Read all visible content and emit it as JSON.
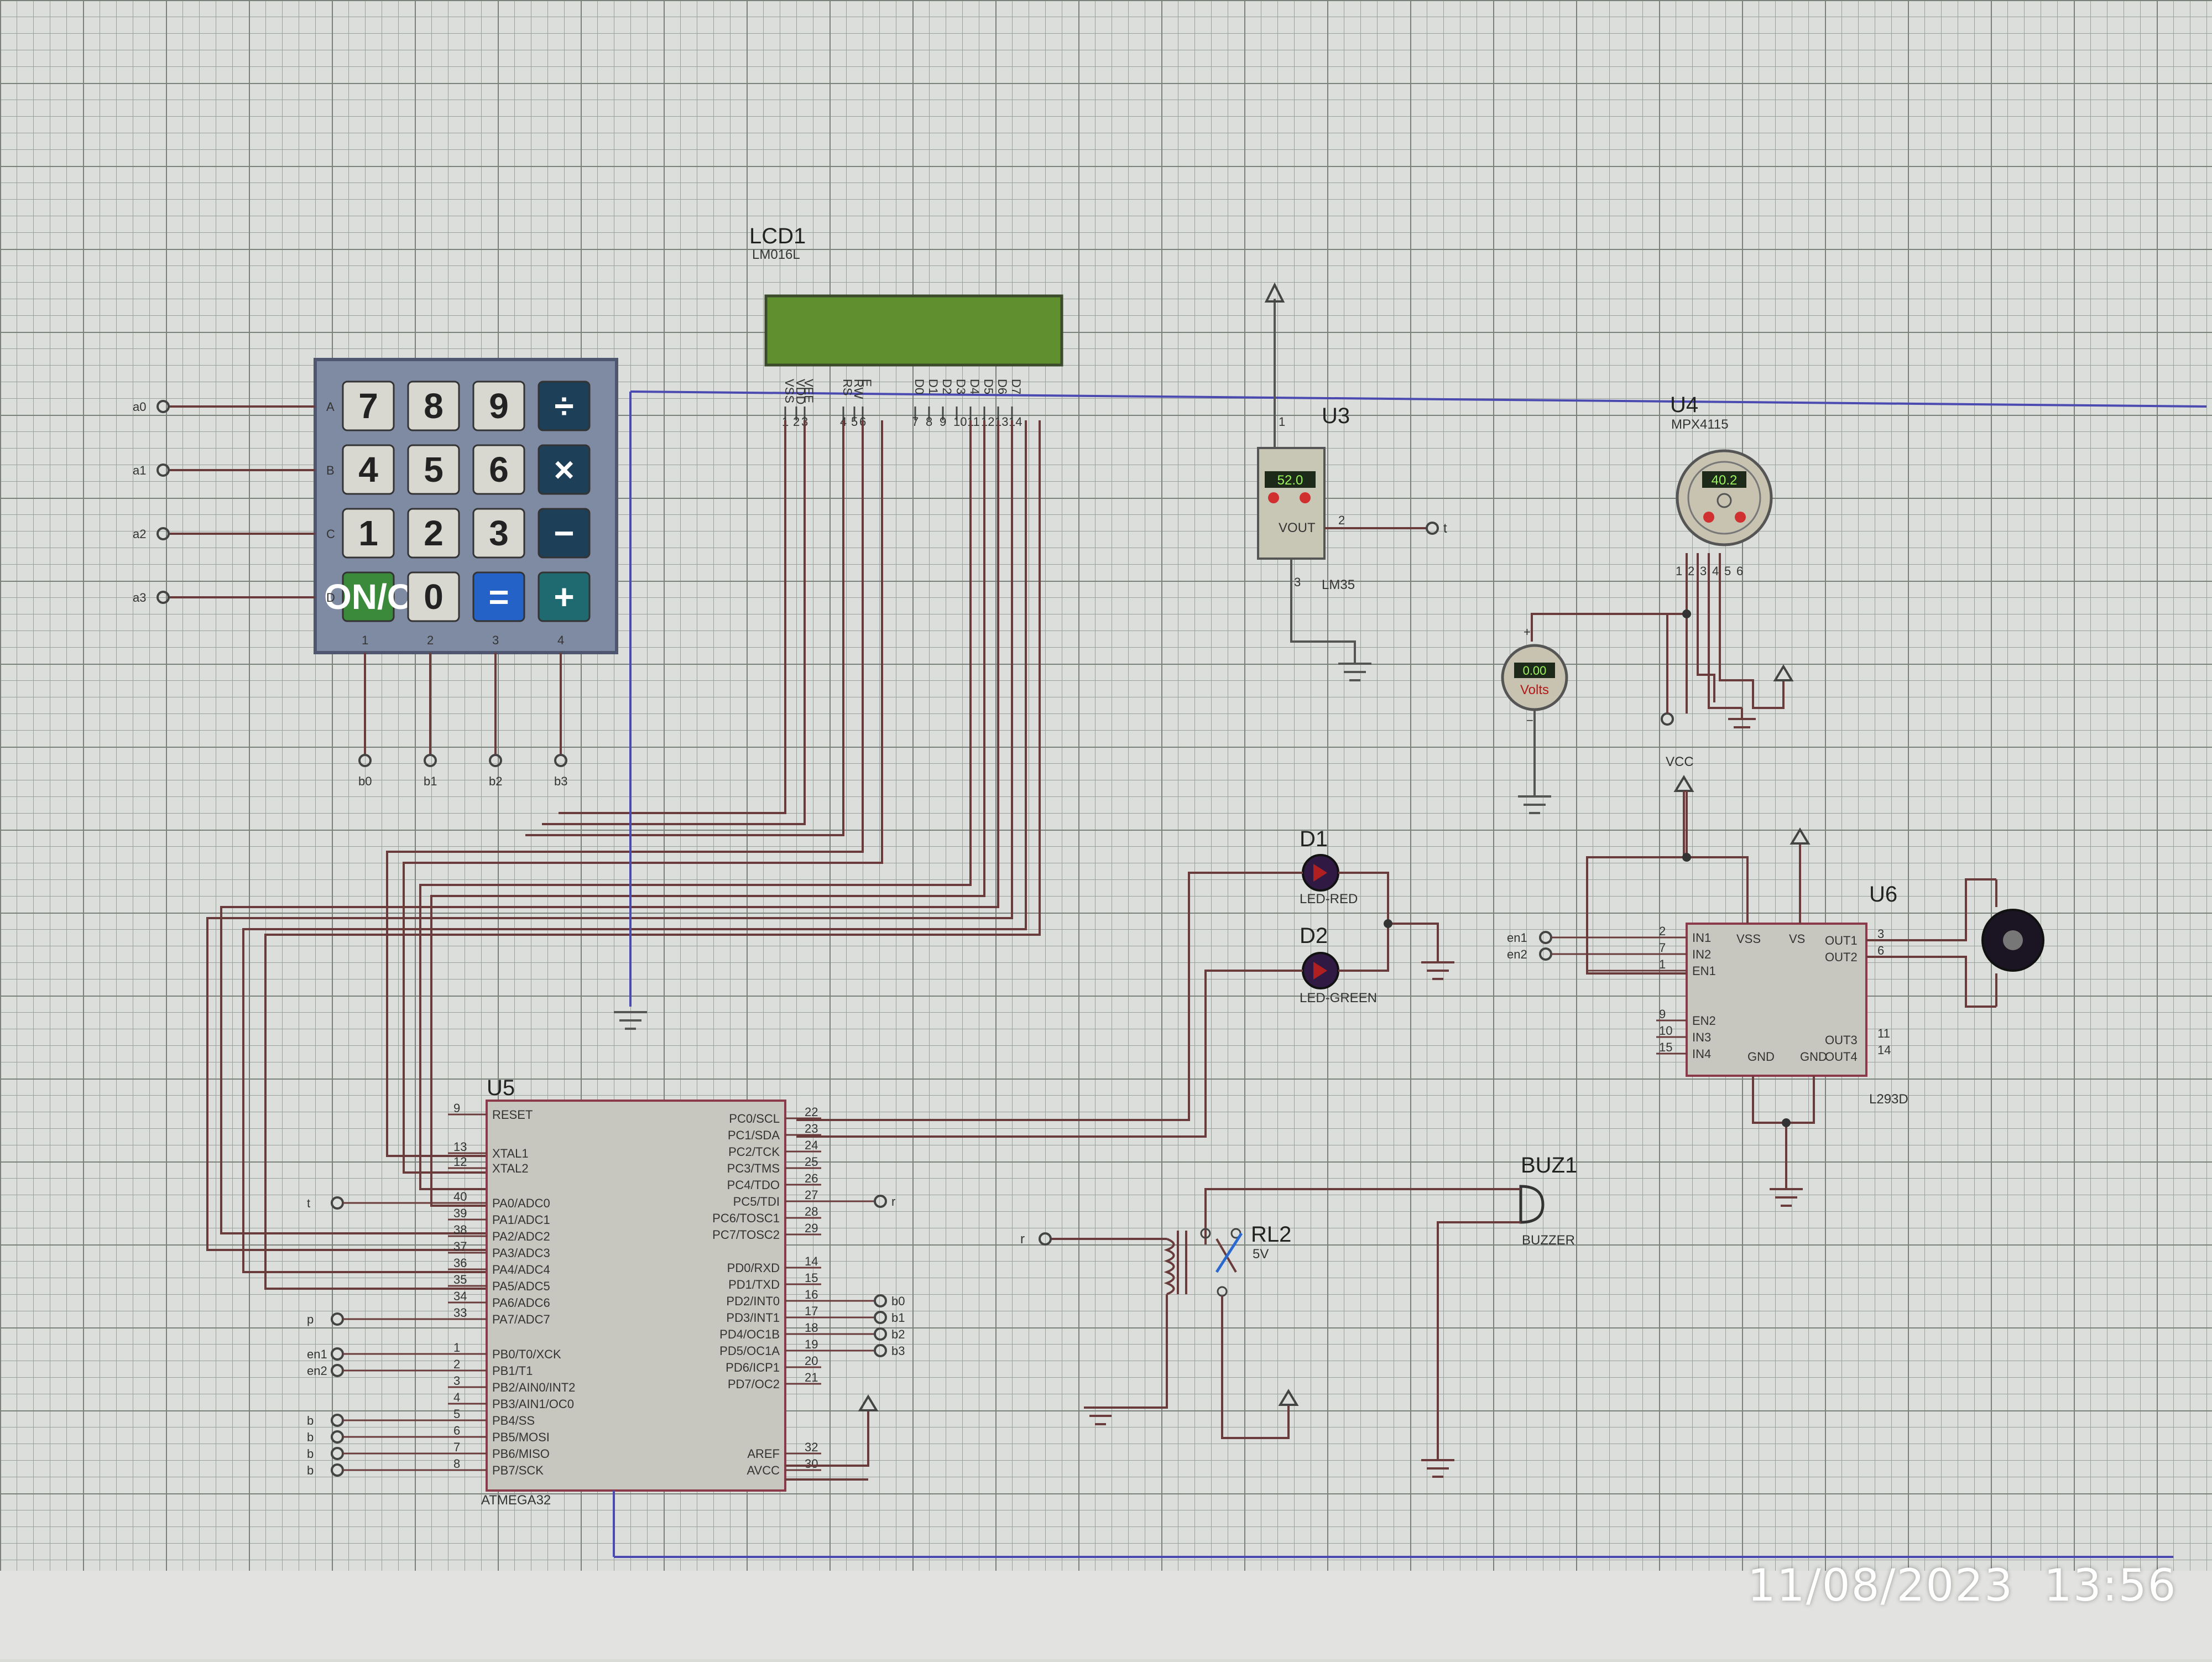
{
  "timestamp": {
    "date": "11/08/2023",
    "time": "13:56"
  },
  "lcd": {
    "ref": "LCD1",
    "model": "LM016L",
    "pins": [
      "VSS",
      "VDD",
      "VEE",
      "RS",
      "RW",
      "E",
      "D0",
      "D1",
      "D2",
      "D3",
      "D4",
      "D5",
      "D6",
      "D7"
    ]
  },
  "keypad": {
    "rows": [
      [
        "7",
        "8",
        "9",
        "÷"
      ],
      [
        "4",
        "5",
        "6",
        "×"
      ],
      [
        "1",
        "2",
        "3",
        "−"
      ],
      [
        "ON/C",
        "0",
        "=",
        "+"
      ]
    ],
    "row_letters": [
      "A",
      "B",
      "C",
      "D"
    ],
    "col_numbers": [
      "1",
      "2",
      "3",
      "4"
    ],
    "row_nets": [
      "a0",
      "a1",
      "a2",
      "a3"
    ],
    "col_nets": [
      "b0",
      "b1",
      "b2",
      "b3"
    ]
  },
  "u3": {
    "ref": "U3",
    "model": "LM35",
    "reading": "52.0",
    "pin_vout": "VOUT",
    "net_out": "t"
  },
  "u4": {
    "ref": "U4",
    "model": "MPX4115",
    "reading": "40.2",
    "pins": [
      "1",
      "2",
      "3",
      "4",
      "5",
      "6"
    ]
  },
  "voltmeter": {
    "reading": "0.00",
    "unit": "Volts"
  },
  "vcc_label": "VCC",
  "d1": {
    "ref": "D1",
    "model": "LED-RED"
  },
  "d2": {
    "ref": "D2",
    "model": "LED-GREEN"
  },
  "u6": {
    "ref": "U6",
    "model": "L293D",
    "left_pins": [
      "IN1",
      "IN2",
      "EN1",
      "EN2",
      "IN3",
      "IN4"
    ],
    "top_pins": [
      "VSS",
      "VS"
    ],
    "right_pins": [
      "OUT1",
      "OUT2",
      "OUT3",
      "OUT4"
    ],
    "bottom_pins": [
      "GND",
      "GND"
    ],
    "nets": [
      "en1",
      "en2"
    ]
  },
  "buz1": {
    "ref": "BUZ1",
    "model": "BUZZER"
  },
  "rl2": {
    "ref": "RL2",
    "model": "5V",
    "net": "r"
  },
  "u5": {
    "ref": "U5",
    "model": "ATMEGA32",
    "left_pins": [
      "RESET",
      "XTAL1",
      "XTAL2",
      "PA0/ADC0",
      "PA1/ADC1",
      "PA2/ADC2",
      "PA3/ADC3",
      "PA4/ADC4",
      "PA5/ADC5",
      "PA6/ADC6",
      "PA7/ADC7",
      "PB0/T0/XCK",
      "PB1/T1",
      "PB2/AIN0/INT2",
      "PB3/AIN1/OC0",
      "PB4/SS",
      "PB5/MOSI",
      "PB6/MISO",
      "PB7/SCK"
    ],
    "left_nums": [
      "9",
      "13",
      "12",
      "40",
      "39",
      "38",
      "37",
      "36",
      "35",
      "34",
      "33",
      "1",
      "2",
      "3",
      "4",
      "5",
      "6",
      "7",
      "8"
    ],
    "right_pins": [
      "PC0/SCL",
      "PC1/SDA",
      "PC2/TCK",
      "PC3/TMS",
      "PC4/TDO",
      "PC5/TDI",
      "PC6/TOSC1",
      "PC7/TOSC2",
      "PD0/RXD",
      "PD1/TXD",
      "PD2/INT0",
      "PD3/INT1",
      "PD4/OC1B",
      "PD5/OC1A",
      "PD6/ICP1",
      "PD7/OC2",
      "AREF",
      "AVCC"
    ],
    "right_nums": [
      "22",
      "23",
      "24",
      "25",
      "26",
      "27",
      "28",
      "29",
      "14",
      "15",
      "16",
      "17",
      "18",
      "19",
      "20",
      "21",
      "32",
      "30"
    ],
    "left_nets": [
      "t",
      "p",
      "en1",
      "en2",
      "b",
      "b",
      "b",
      "b"
    ],
    "right_nets": [
      "r",
      "b0",
      "b1",
      "b2",
      "b3"
    ]
  }
}
